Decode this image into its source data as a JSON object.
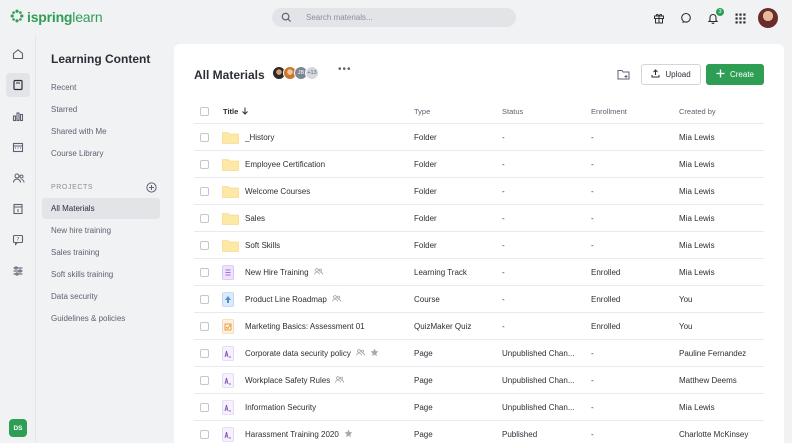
{
  "brand": {
    "logo_bold": "ispring",
    "logo_thin": "learn",
    "accent": "#2f9e55"
  },
  "search": {
    "placeholder": "Search materials..."
  },
  "topbar": {
    "notifications_count": "3"
  },
  "rail": {
    "user_initials": "DS"
  },
  "sidebar": {
    "title": "Learning Content",
    "links": [
      "Recent",
      "Starred",
      "Shared with Me",
      "Course Library"
    ],
    "projects_label": "PROJECTS",
    "projects": [
      "All Materials",
      "New hire training",
      "Sales training",
      "Soft skills training",
      "Data security",
      "Guidelines & policies"
    ],
    "active_project": "All Materials"
  },
  "main": {
    "title": "All Materials",
    "collaborators": {
      "initials": "JB",
      "extra": "+13"
    },
    "upload_label": "Upload",
    "create_label": "Create"
  },
  "table": {
    "headers": {
      "title": "Title",
      "type": "Type",
      "status": "Status",
      "enrollment": "Enrollment",
      "created_by": "Created by"
    },
    "rows": [
      {
        "icon": "folder-icon",
        "title": "_History",
        "type": "Folder",
        "status": "-",
        "enrollment": "-",
        "created_by": "Mia Lewis",
        "shared": false,
        "starred": false
      },
      {
        "icon": "folder-icon",
        "title": "Employee Certification",
        "type": "Folder",
        "status": "-",
        "enrollment": "-",
        "created_by": "Mia Lewis",
        "shared": false,
        "starred": false
      },
      {
        "icon": "folder-icon",
        "title": "Welcome Courses",
        "type": "Folder",
        "status": "-",
        "enrollment": "-",
        "created_by": "Mia Lewis",
        "shared": false,
        "starred": false
      },
      {
        "icon": "folder-icon",
        "title": "Sales",
        "type": "Folder",
        "status": "-",
        "enrollment": "-",
        "created_by": "Mia Lewis",
        "shared": false,
        "starred": false
      },
      {
        "icon": "folder-icon",
        "title": "Soft Skills",
        "type": "Folder",
        "status": "-",
        "enrollment": "-",
        "created_by": "Mia Lewis",
        "shared": false,
        "starred": false
      },
      {
        "icon": "learning-track-icon",
        "title": "New Hire Training",
        "type": "Learning Track",
        "status": "-",
        "enrollment": "Enrolled",
        "created_by": "Mia Lewis",
        "shared": true,
        "starred": false
      },
      {
        "icon": "course-icon",
        "title": "Product Line Roadmap",
        "type": "Course",
        "status": "-",
        "enrollment": "Enrolled",
        "created_by": "You",
        "shared": true,
        "starred": false
      },
      {
        "icon": "quiz-icon",
        "title": "Marketing Basics: Assessment 01",
        "type": "QuizMaker Quiz",
        "status": "-",
        "enrollment": "Enrolled",
        "created_by": "You",
        "shared": false,
        "starred": false
      },
      {
        "icon": "page-icon",
        "title": "Corporate data security policy",
        "type": "Page",
        "status": "Unpublished Chan...",
        "enrollment": "-",
        "created_by": "Pauline Fernandez",
        "shared": true,
        "starred": true
      },
      {
        "icon": "page-icon",
        "title": "Workplace Safety Rules",
        "type": "Page",
        "status": "Unpublished Chan...",
        "enrollment": "-",
        "created_by": "Matthew Deems",
        "shared": true,
        "starred": false
      },
      {
        "icon": "page-icon",
        "title": "Information Security",
        "type": "Page",
        "status": "Unpublished Chan...",
        "enrollment": "-",
        "created_by": "Mia Lewis",
        "shared": false,
        "starred": false
      },
      {
        "icon": "page-icon",
        "title": "Harassment Training 2020",
        "type": "Page",
        "status": "Published",
        "enrollment": "-",
        "created_by": "Charlotte McKinsey",
        "shared": false,
        "starred": true
      }
    ]
  }
}
